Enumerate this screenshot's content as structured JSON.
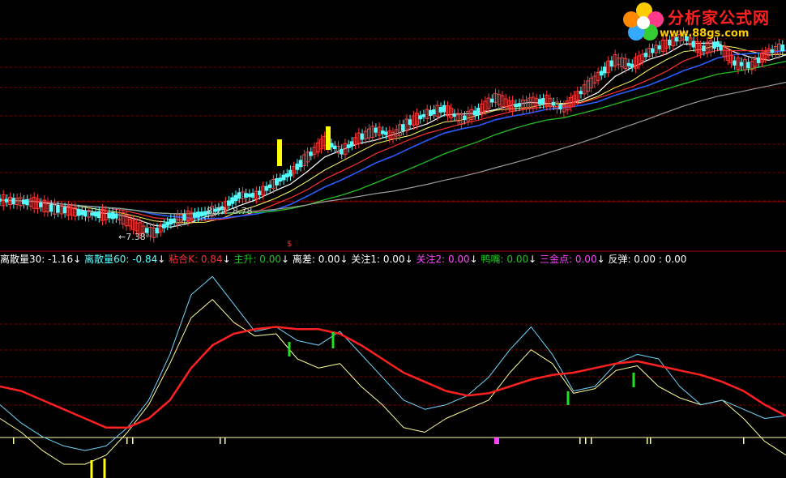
{
  "colors": {
    "background": "#000000",
    "grid": "#7a0000",
    "up_candle": "#ff3a3a",
    "down_candle": "#54ffff",
    "ma5": "#ffffff",
    "ma10": "#ffff66",
    "ma20": "#ff3030",
    "ma30": "#2a5cff",
    "ma60": "#22c022",
    "ma120": "#9a9a9a"
  },
  "logo": {
    "title": "分析家公式网",
    "url": "www.88gs.com",
    "icon": "flower-logo-icon"
  },
  "price_panel": {
    "low_label": "7.38",
    "price_labels": [
      "8.77",
      "8.78"
    ],
    "marker": "$"
  },
  "indicator_legend": [
    {
      "text": "离散量30: -1.16",
      "color": "#ffffff"
    },
    {
      "text": "离散量60: -0.84",
      "color": "#54ffff"
    },
    {
      "text": "粘合K: 0.84",
      "color": "#ff3030"
    },
    {
      "text": "主升: 0.00",
      "color": "#22c022"
    },
    {
      "text": "离差: 0.00",
      "color": "#ffffff"
    },
    {
      "text": "关注1: 0.00",
      "color": "#ffffff"
    },
    {
      "text": "关注2: 0.00",
      "color": "#ff44ff"
    },
    {
      "text": "鸭嘴: 0.00",
      "color": "#22c022"
    },
    {
      "text": "三金点: 0.00",
      "color": "#ff44ff"
    },
    {
      "text": "反弹: 0.00 : 0.00",
      "color": "#ffffff"
    }
  ],
  "chart_data": [
    {
      "type": "line",
      "title": "",
      "series": [
        {
          "values": [
            8.6,
            8.55,
            8.5,
            8.3,
            8.2,
            8.1,
            8.05,
            8.0,
            7.6,
            7.38,
            7.8,
            8.0,
            8.1,
            8.3,
            8.77,
            8.78,
            9.2,
            9.6,
            10.2,
            10.8,
            10.4,
            10.9,
            11.2,
            11.0,
            11.5,
            11.8,
            12.0,
            11.6,
            11.9,
            12.4,
            12.1,
            12.2,
            12.3,
            12.0,
            12.6,
            13.2,
            13.8,
            13.6,
            14.1,
            14.4,
            14.7,
            14.2,
            14.4,
            13.7,
            13.6,
            14.1,
            14.3
          ]
        }
      ]
    },
    {
      "type": "line",
      "title": "",
      "series": [
        {
          "name": "离散量30",
          "values": [
            -0.9,
            -1.2,
            -1.6,
            -1.9,
            -1.9,
            -1.7,
            -1.2,
            -0.6,
            0.3,
            1.3,
            1.7,
            1.2,
            0.9,
            0.95,
            0.4,
            0.2,
            0.3,
            -0.2,
            -0.6,
            -1.1,
            -1.2,
            -0.9,
            -0.7,
            -0.5,
            0.1,
            0.6,
            0.3,
            -0.35,
            -0.25,
            0.15,
            0.25,
            -0.2,
            -0.45,
            -0.6,
            -0.5,
            -0.9,
            -1.4,
            -1.7
          ]
        },
        {
          "name": "离散量60",
          "values": [
            -0.6,
            -1.0,
            -1.3,
            -1.5,
            -1.6,
            -1.5,
            -1.1,
            -0.5,
            0.5,
            1.8,
            2.2,
            1.6,
            1.0,
            1.1,
            0.8,
            0.7,
            1.0,
            0.5,
            0.0,
            -0.5,
            -0.7,
            -0.6,
            -0.4,
            0.0,
            0.6,
            1.1,
            0.5,
            -0.3,
            -0.2,
            0.3,
            0.5,
            0.4,
            -0.2,
            -0.6,
            -0.5,
            -0.7,
            -0.9,
            -0.84
          ]
        },
        {
          "name": "粘合K",
          "values": [
            -0.2,
            -0.3,
            -0.5,
            -0.7,
            -0.9,
            -1.1,
            -1.1,
            -0.9,
            -0.5,
            0.2,
            0.7,
            0.95,
            1.05,
            1.1,
            1.05,
            1.05,
            0.95,
            0.7,
            0.4,
            0.1,
            -0.1,
            -0.3,
            -0.4,
            -0.35,
            -0.2,
            -0.05,
            0.05,
            0.1,
            0.2,
            0.3,
            0.35,
            0.25,
            0.15,
            0.05,
            -0.1,
            -0.3,
            -0.6,
            -0.84
          ]
        }
      ]
    }
  ]
}
